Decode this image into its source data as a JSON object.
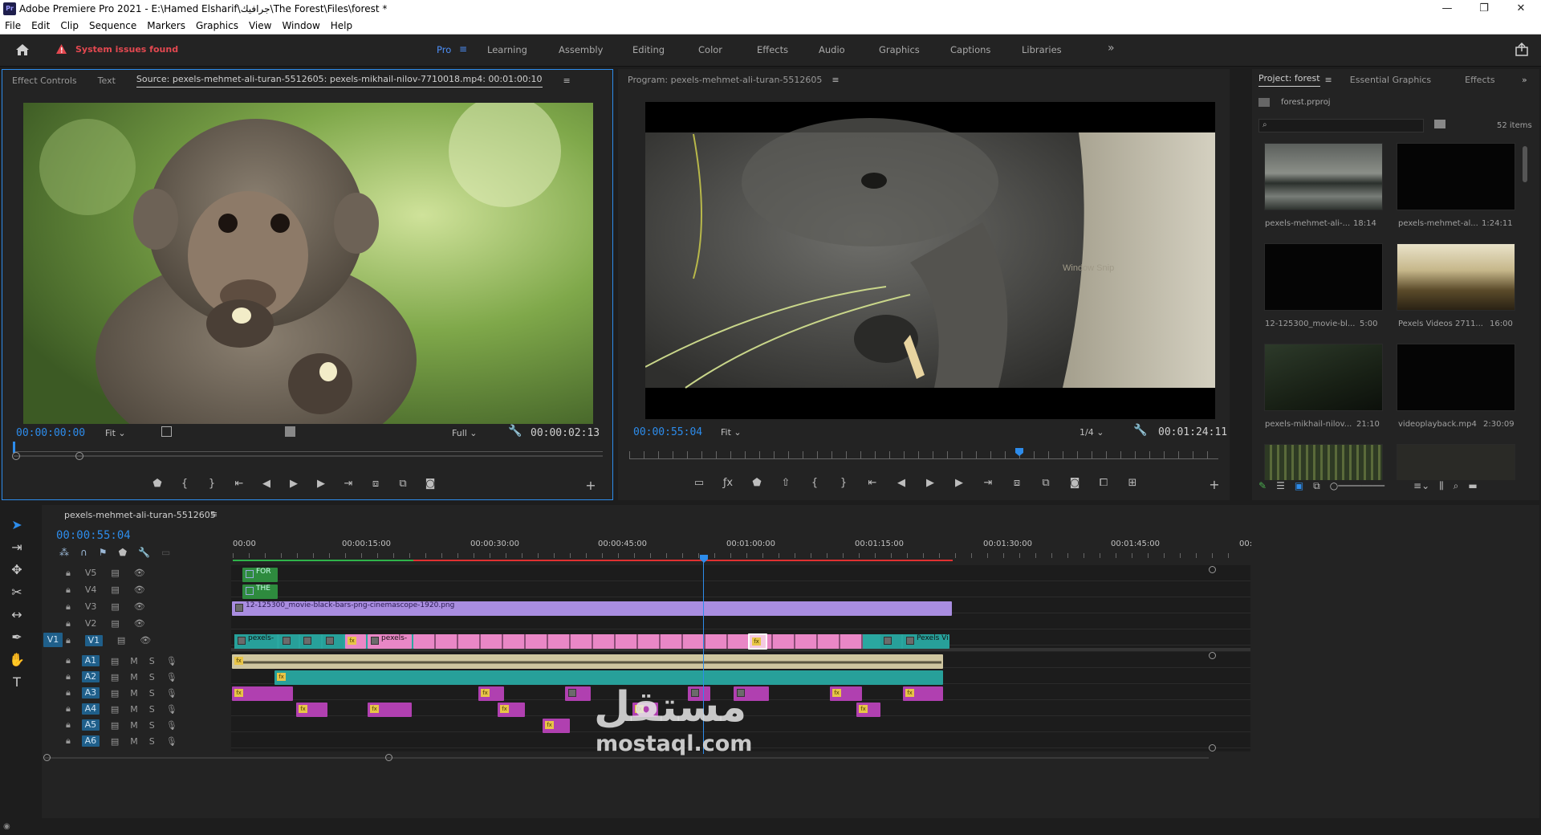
{
  "window": {
    "title": "Adobe Premiere Pro 2021 - E:\\Hamed Elsharif\\جرافيك\\The Forest\\Files\\forest *",
    "app_badge": "Pr",
    "controls": [
      "—",
      "❐",
      "✕"
    ]
  },
  "menu": [
    "File",
    "Edit",
    "Clip",
    "Sequence",
    "Markers",
    "Graphics",
    "View",
    "Window",
    "Help"
  ],
  "workspace": {
    "warning": "System issues found",
    "tabs": [
      "Pro",
      "Learning",
      "Assembly",
      "Editing",
      "Color",
      "Effects",
      "Audio",
      "Graphics",
      "Captions",
      "Libraries"
    ],
    "active": "Pro",
    "more": "»"
  },
  "source": {
    "tabs": [
      "Effect Controls",
      "Text",
      "Source: pexels-mehmet-ali-turan-5512605: pexels-mikhail-nilov-7710018.mp4: 00:01:00:10"
    ],
    "timecode": "00:00:00:00",
    "fit": "Fit",
    "quality": "Full",
    "duration": "00:00:02:13"
  },
  "program": {
    "tab": "Program: pexels-mehmet-ali-turan-5512605",
    "timecode": "00:00:55:04",
    "fit": "Fit",
    "quality": "1/4",
    "duration": "00:01:24:11",
    "watermark": "Window Snip"
  },
  "project": {
    "tabs": [
      "Project: forest",
      "Essential Graphics",
      "Effects"
    ],
    "file": "forest.prproj",
    "item_count": "52 items",
    "items": [
      {
        "name": "pexels-mehmet-ali-...",
        "dur": "18:14",
        "kind": "mist"
      },
      {
        "name": "pexels-mehmet-al...",
        "dur": "1:24:11",
        "kind": "black"
      },
      {
        "name": "12-125300_movie-bl...",
        "dur": "5:00",
        "kind": "black"
      },
      {
        "name": "Pexels Videos 2711...",
        "dur": "16:00",
        "kind": "sunrise"
      },
      {
        "name": "pexels-mikhail-nilov...",
        "dur": "21:10",
        "kind": "forest"
      },
      {
        "name": "videoplayback.mp4",
        "dur": "2:30:09",
        "kind": "black"
      }
    ]
  },
  "timeline": {
    "sequence": "pexels-mehmet-ali-turan-5512605",
    "timecode": "00:00:55:04",
    "ruler": [
      "00:00",
      "00:00:15:00",
      "00:00:30:00",
      "00:00:45:00",
      "00:01:00:00",
      "00:01:15:00",
      "00:01:30:00",
      "00:01:45:00",
      "00:"
    ],
    "video_tracks": [
      "V5",
      "V4",
      "V3",
      "V2",
      "V1"
    ],
    "audio_tracks": [
      "A1",
      "A2",
      "A3",
      "A4",
      "A5",
      "A6"
    ],
    "source_patch_video": "V1",
    "mute": "M",
    "solo": "S",
    "v5_clip": "FOR",
    "v4_clip": "THE",
    "v3_clip": "12-125300_movie-black-bars-png-cinemascope-1920.png",
    "v1_label_a": "pexels-",
    "v1_label_b": "pexels-",
    "v1_label_end": "Pexels Vi",
    "fx": "fx"
  },
  "watermark": {
    "arabic": "مستقل",
    "latin": "mostaql.com"
  }
}
